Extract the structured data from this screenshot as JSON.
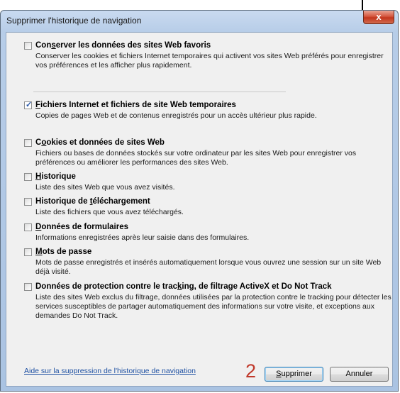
{
  "window": {
    "title": "Supprimer l'historique de navigation",
    "close_glyph": "x"
  },
  "options": [
    {
      "id": "favoris",
      "checked": false,
      "accel": "s",
      "label_pre": "Con",
      "label_post": "erver les données des sites Web favoris",
      "desc": "Conserver les cookies et fichiers Internet temporaires qui activent vos sites Web préférés pour enregistrer vos préférences et les afficher plus rapidement."
    },
    {
      "id": "temp",
      "checked": true,
      "accel": "F",
      "label_pre": "",
      "label_post": "ichiers Internet et fichiers de site Web temporaires",
      "desc": "Copies de pages Web et de contenus enregistrés pour un accès ultérieur plus rapide."
    },
    {
      "id": "cookies",
      "checked": false,
      "accel": "o",
      "label_pre": "C",
      "label_post": "okies et données de sites Web",
      "desc": "Fichiers ou bases de données stockés sur votre ordinateur par les sites Web pour enregistrer vos préférences ou améliorer les performances des sites Web."
    },
    {
      "id": "historique",
      "checked": false,
      "accel": "H",
      "label_pre": "",
      "label_post": "istorique",
      "desc": "Liste des sites Web que vous avez visités."
    },
    {
      "id": "telechargement",
      "checked": false,
      "accel": "t",
      "label_pre": "Historique de ",
      "label_post": "éléchargement",
      "desc": "Liste des fichiers que vous avez téléchargés."
    },
    {
      "id": "formulaires",
      "checked": false,
      "accel": "D",
      "label_pre": "",
      "label_post": "onnées de formulaires",
      "desc": "Informations enregistrées après leur saisie dans des formulaires."
    },
    {
      "id": "motsdepasse",
      "checked": false,
      "accel": "M",
      "label_pre": "",
      "label_post": "ots de passe",
      "desc": "Mots de passe enregistrés et insérés automatiquement lorsque vous ouvrez une session sur un site Web déjà visité."
    },
    {
      "id": "tracking",
      "checked": false,
      "accel": "k",
      "label_pre": "Données de protection contre le trac",
      "label_post": "ing, de filtrage ActiveX et Do Not Track",
      "desc": "Liste des sites Web exclus du filtrage, données utilisées par la protection contre le tracking pour détecter les services susceptibles de partager automatiquement des informations sur votre visite, et exceptions aux demandes Do Not Track."
    }
  ],
  "footer": {
    "help_link": "Aide sur la suppression de l'historique de navigation",
    "annotation": "2",
    "delete_accel": "S",
    "delete_rest": "upprimer",
    "cancel": "Annuler"
  },
  "colors": {
    "link": "#1e50a2",
    "annotation": "#c0392b",
    "titlebar": "#b7cde8",
    "close": "#c3361d"
  }
}
